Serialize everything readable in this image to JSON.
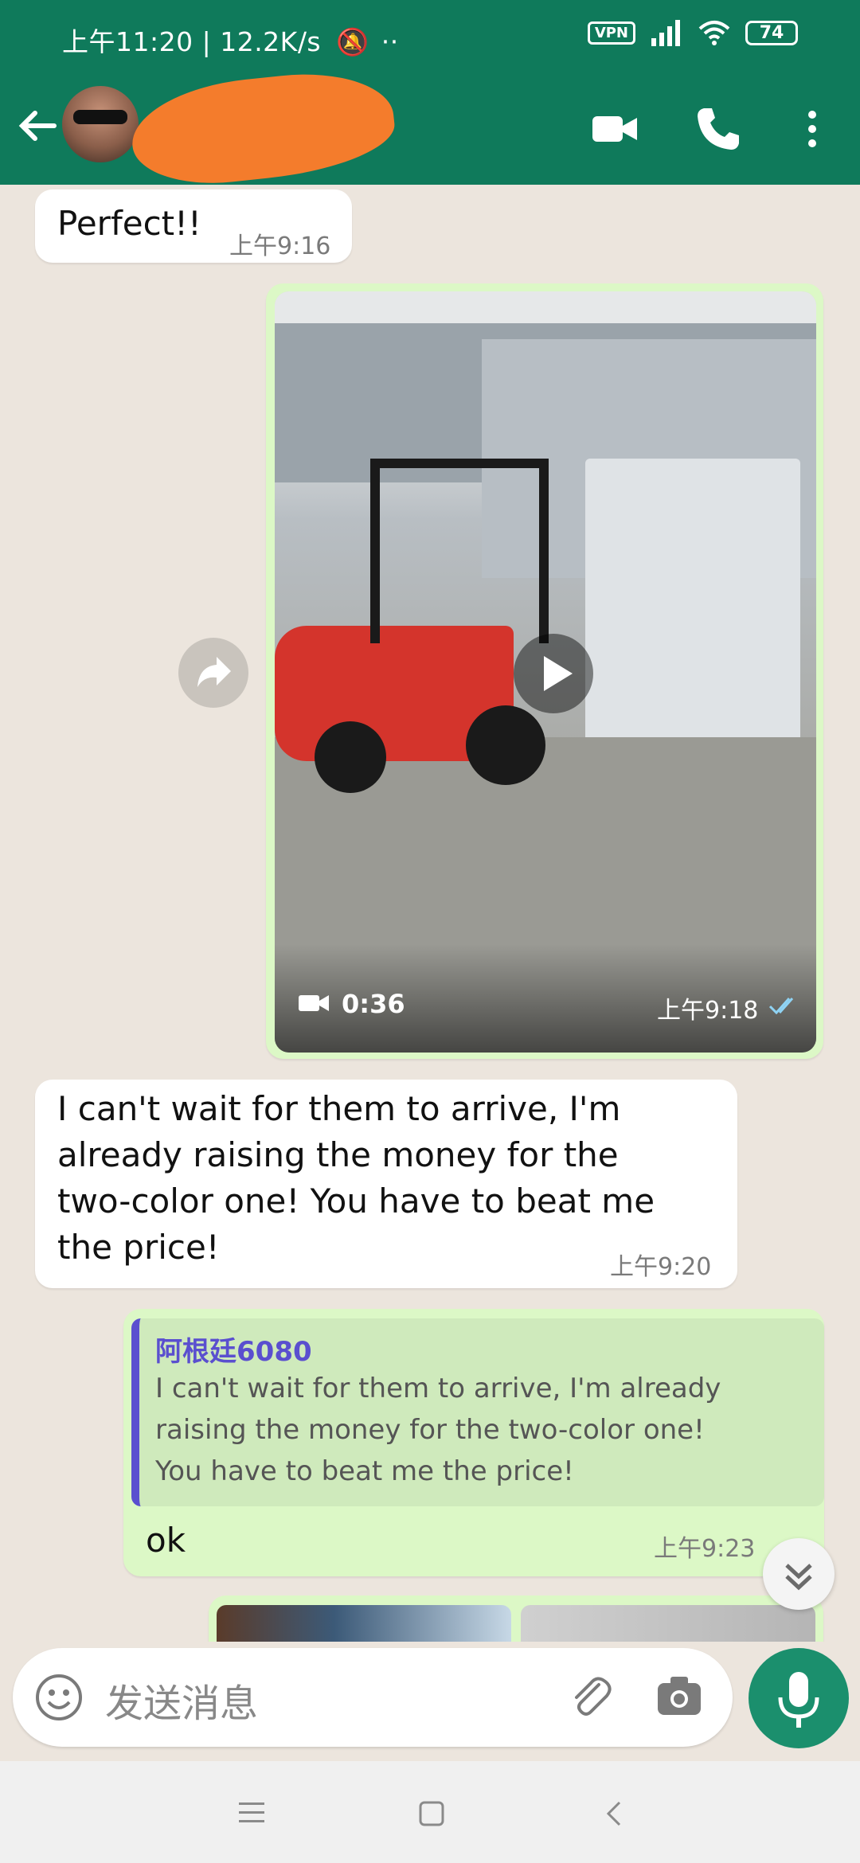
{
  "status_bar": {
    "left_text": "上午11:20 | 12.2K/s",
    "vpn": "VPN",
    "battery": "74"
  },
  "header": {
    "contact_name": "",
    "icons": [
      "back-arrow-icon",
      "video-call-icon",
      "voice-call-icon",
      "more-vert-icon"
    ]
  },
  "messages": {
    "m1": {
      "text": "Perfect!!",
      "time": "上午9:16"
    },
    "video": {
      "duration": "0:36",
      "time": "上午9:18"
    },
    "m3": {
      "lines": [
        "I can't wait for them to arrive, I'm",
        "already raising the money for the",
        "two-color one! You have to beat me",
        "the price!"
      ],
      "time": "上午9:20"
    },
    "reply": {
      "quoted_author": "阿根廷6080",
      "quoted_lines": [
        "I can't wait for them to arrive, I'm already",
        "raising the money for the two-color one!",
        "You have to beat me the price!"
      ],
      "text": "ok",
      "time": "上午9:23"
    }
  },
  "composer": {
    "placeholder": "发送消息"
  },
  "colors": {
    "header_green": "#0f7a5b",
    "outgoing_bubble": "#dcf8c6",
    "incoming_bubble": "#ffffff",
    "chat_bg": "#ece5dd",
    "quote_bar": "#5a4fcf",
    "mic_button": "#1b8f6d"
  }
}
